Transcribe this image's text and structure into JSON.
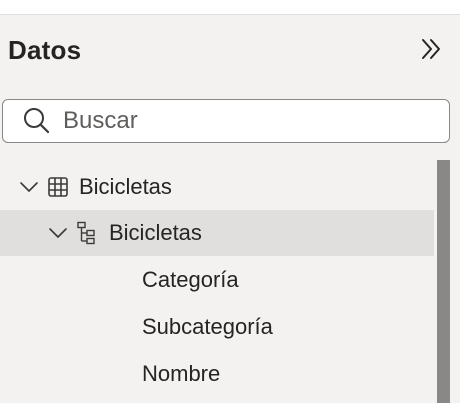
{
  "pane": {
    "title": "Datos",
    "collapse_icon": "double-chevron-right-icon"
  },
  "search": {
    "placeholder": "Buscar",
    "value": "",
    "icon": "search-icon"
  },
  "tree": {
    "table": {
      "label": "Bicicletas",
      "icon": "table-icon",
      "expanded": true
    },
    "hierarchy": {
      "label": "Bicicletas",
      "icon": "hierarchy-icon",
      "expanded": true,
      "selected": true,
      "levels": [
        {
          "label": "Categoría"
        },
        {
          "label": "Subcategoría"
        },
        {
          "label": "Nombre"
        }
      ]
    }
  },
  "colors": {
    "accent": "#117865",
    "selected_bg": "#e1dfdd",
    "pane_bg": "#f3f2f1",
    "scrollbar": "#8a8886"
  }
}
